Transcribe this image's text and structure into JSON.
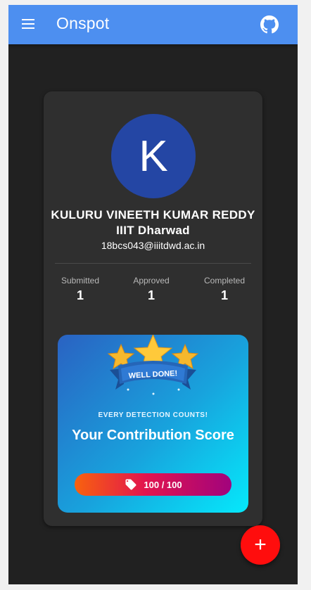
{
  "app": {
    "title": "Onspot",
    "menu_icon": "hamburger-menu-icon",
    "github_icon": "github-icon"
  },
  "profile": {
    "avatar_letter": "K",
    "avatar_color": "#2446a4",
    "name": "KULURU VINEETH KUMAR REDDY IIIT Dharwad",
    "email": "18bcs043@iiitdwd.ac.in"
  },
  "stats": [
    {
      "label": "Submitted",
      "value": "1"
    },
    {
      "label": "Approved",
      "value": "1"
    },
    {
      "label": "Completed",
      "value": "1"
    }
  ],
  "score_card": {
    "badge_text": "WELL DONE!",
    "tagline": "EVERY DETECTION COUNTS!",
    "title": "Your Contribution Score",
    "score": "100 / 100",
    "score_icon": "tag-icon"
  },
  "fab": {
    "label": "+",
    "icon": "plus-icon",
    "color": "#ff0d0d"
  },
  "colors": {
    "appbar": "#4d8ff0",
    "background": "#212121",
    "card": "#2f2f2f"
  }
}
